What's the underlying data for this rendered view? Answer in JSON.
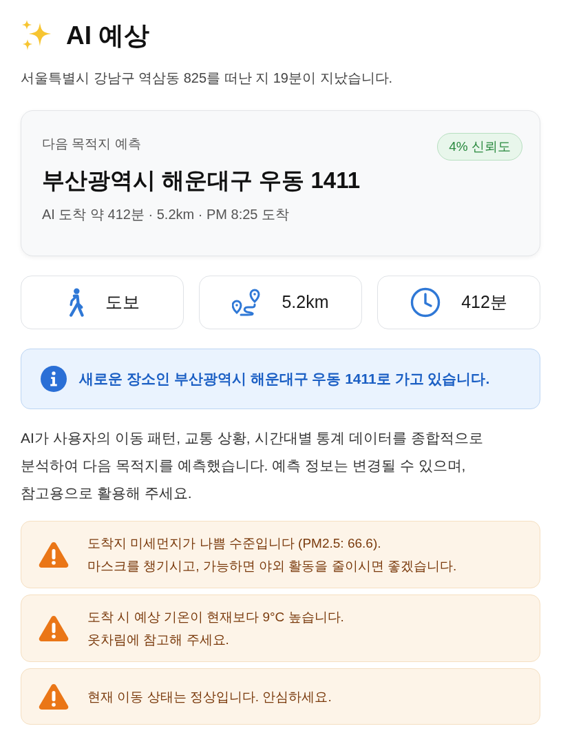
{
  "header": {
    "title": "AI 예상",
    "subtitle": "서울특별시 강남구 역삼동 825를 떠난 지 19분이 지났습니다."
  },
  "prediction_card": {
    "label": "다음 목적지 예측",
    "confidence": "4% 신뢰도",
    "destination": "부산광역시 해운대구 우동 1411",
    "details": "AI 도착 약 412분 · 5.2km · PM 8:25 도착"
  },
  "stats": [
    {
      "kind": "walk",
      "value": "도보"
    },
    {
      "kind": "route",
      "value": "5.2km"
    },
    {
      "kind": "time",
      "value": "412분"
    }
  ],
  "notice": {
    "text": "새로운 장소인 부산광역시 해운대구 우동 1411로 가고 있습니다."
  },
  "description": "AI가 사용자의 이동 패턴, 교통 상황, 시간대별 통계 데이터를 종합적으로 분석하여 다음 목적지를 예측했습니다. 예측 정보는 변경될 수 있으며, 참고용으로 활용해 주세요.",
  "warnings": [
    {
      "lines": [
        "도착지 미세먼지가 나쁨 수준입니다 (PM2.5: 66.6).",
        "마스크를 챙기시고, 가능하면 야외 활동을 줄이시면 좋겠습니다."
      ]
    },
    {
      "lines": [
        "도착 시 예상 기온이 현재보다 9°C 높습니다.",
        "옷차림에 참고해 주세요."
      ]
    },
    {
      "lines": [
        "현재 이동 상태는 정상입니다. 안심하세요."
      ]
    }
  ]
}
